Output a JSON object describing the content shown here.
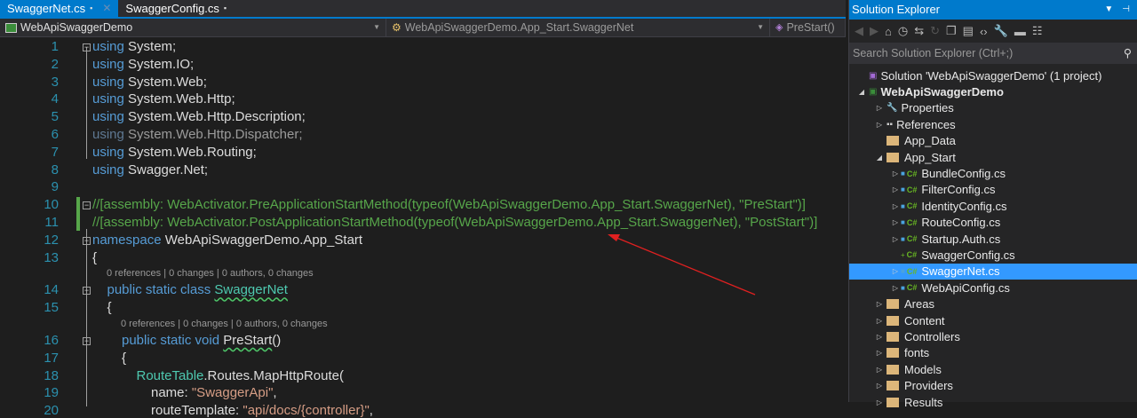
{
  "tabs": [
    {
      "label": "SwaggerNet.cs",
      "active": true
    },
    {
      "label": "SwaggerConfig.cs",
      "active": false
    }
  ],
  "navbar": {
    "project": "WebApiSwaggerDemo",
    "type": "WebApiSwaggerDemo.App_Start.SwaggerNet",
    "member": "PreStart()"
  },
  "code": [
    {
      "n": "1",
      "indent": 0,
      "t": [
        [
          "using",
          "kw"
        ],
        [
          " System;",
          ""
        ]
      ]
    },
    {
      "n": "2",
      "indent": 0,
      "t": [
        [
          "using",
          "kw"
        ],
        [
          " System.IO;",
          ""
        ]
      ]
    },
    {
      "n": "3",
      "indent": 0,
      "t": [
        [
          "using",
          "kw"
        ],
        [
          " System.Web;",
          ""
        ]
      ]
    },
    {
      "n": "4",
      "indent": 0,
      "t": [
        [
          "using",
          "kw"
        ],
        [
          " System.Web.Http;",
          ""
        ]
      ]
    },
    {
      "n": "5",
      "indent": 0,
      "t": [
        [
          "using",
          "kw"
        ],
        [
          " System.Web.Http.Description;",
          ""
        ]
      ]
    },
    {
      "n": "6",
      "indent": 0,
      "t": [
        [
          "using",
          "dimu"
        ],
        [
          " System.Web.Http.Dispatcher;",
          "dimt"
        ]
      ]
    },
    {
      "n": "7",
      "indent": 0,
      "t": [
        [
          "using",
          "kw"
        ],
        [
          " System.Web.Routing;",
          ""
        ]
      ]
    },
    {
      "n": "8",
      "indent": 0,
      "t": [
        [
          "using",
          "kw"
        ],
        [
          " Swagger.Net;",
          ""
        ]
      ]
    },
    {
      "n": "9",
      "indent": 0,
      "t": []
    },
    {
      "n": "10",
      "indent": 0,
      "t": [
        [
          "//[assembly: WebActivator.PreApplicationStartMethod(typeof(WebApiSwaggerDemo.App_Start.SwaggerNet), \"PreStart\")]",
          "cm"
        ]
      ]
    },
    {
      "n": "11",
      "indent": 0,
      "t": [
        [
          "//[assembly: WebActivator.PostApplicationStartMethod(typeof(WebApiSwaggerDemo.App_Start.SwaggerNet), \"PostStart\")]",
          "cm"
        ]
      ]
    },
    {
      "n": "12",
      "indent": 0,
      "t": [
        [
          "namespace",
          "kw"
        ],
        [
          " WebApiSwaggerDemo.App_Start",
          ""
        ]
      ]
    },
    {
      "n": "13",
      "indent": 0,
      "t": [
        [
          "{",
          ""
        ]
      ]
    },
    {
      "n": "14",
      "indent": 1,
      "lens": "0 references | 0 changes | 0 authors, 0 changes",
      "t": [
        [
          "public static class",
          "kw"
        ],
        [
          " ",
          ""
        ],
        [
          "SwaggerNet",
          "ty sq"
        ]
      ]
    },
    {
      "n": "15",
      "indent": 1,
      "t": [
        [
          "{",
          ""
        ]
      ]
    },
    {
      "n": "16",
      "indent": 2,
      "lens": "0 references | 0 changes | 0 authors, 0 changes",
      "t": [
        [
          "public static void",
          "kw"
        ],
        [
          " ",
          ""
        ],
        [
          "PreStart",
          "sq"
        ],
        [
          "()",
          ""
        ]
      ]
    },
    {
      "n": "17",
      "indent": 2,
      "t": [
        [
          "{",
          ""
        ]
      ]
    },
    {
      "n": "18",
      "indent": 3,
      "t": [
        [
          "RouteTable",
          "ty"
        ],
        [
          ".Routes.MapHttpRoute(",
          ""
        ]
      ]
    },
    {
      "n": "19",
      "indent": 4,
      "t": [
        [
          "name: ",
          ""
        ],
        [
          "\"SwaggerApi\"",
          "st"
        ],
        [
          ",",
          ""
        ]
      ]
    },
    {
      "n": "20",
      "indent": 4,
      "t": [
        [
          "routeTemplate: ",
          ""
        ],
        [
          "\"api/docs/{controller}\"",
          "st"
        ],
        [
          ",",
          ""
        ]
      ]
    }
  ],
  "solution_explorer": {
    "title": "Solution Explorer",
    "search_placeholder": "Search Solution Explorer (Ctrl+;)",
    "items": [
      {
        "label": "Solution 'WebApiSwaggerDemo' (1 project)",
        "level": 0,
        "kind": "solution",
        "arrow": ""
      },
      {
        "label": "WebApiSwaggerDemo",
        "level": 0,
        "kind": "project",
        "arrow": "◢",
        "bold": true
      },
      {
        "label": "Properties",
        "level": 1,
        "kind": "props",
        "arrow": "▷"
      },
      {
        "label": "References",
        "level": 1,
        "kind": "refs",
        "arrow": "▷"
      },
      {
        "label": "App_Data",
        "level": 1,
        "kind": "folder",
        "arrow": ""
      },
      {
        "label": "App_Start",
        "level": 1,
        "kind": "folder",
        "arrow": "◢"
      },
      {
        "label": "BundleConfig.cs",
        "level": 2,
        "kind": "cs",
        "arrow": "▷"
      },
      {
        "label": "FilterConfig.cs",
        "level": 2,
        "kind": "cs",
        "arrow": "▷"
      },
      {
        "label": "IdentityConfig.cs",
        "level": 2,
        "kind": "cs",
        "arrow": "▷"
      },
      {
        "label": "RouteConfig.cs",
        "level": 2,
        "kind": "cs",
        "arrow": "▷"
      },
      {
        "label": "Startup.Auth.cs",
        "level": 2,
        "kind": "cs",
        "arrow": "▷"
      },
      {
        "label": "SwaggerConfig.cs",
        "level": 2,
        "kind": "cs-add",
        "arrow": ""
      },
      {
        "label": "SwaggerNet.cs",
        "level": 2,
        "kind": "cs",
        "arrow": "▷",
        "selected": true
      },
      {
        "label": "WebApiConfig.cs",
        "level": 2,
        "kind": "cs",
        "arrow": "▷"
      },
      {
        "label": "Areas",
        "level": 1,
        "kind": "folder",
        "arrow": "▷"
      },
      {
        "label": "Content",
        "level": 1,
        "kind": "folder",
        "arrow": "▷"
      },
      {
        "label": "Controllers",
        "level": 1,
        "kind": "folder",
        "arrow": "▷"
      },
      {
        "label": "fonts",
        "level": 1,
        "kind": "folder",
        "arrow": "▷"
      },
      {
        "label": "Models",
        "level": 1,
        "kind": "folder",
        "arrow": "▷"
      },
      {
        "label": "Providers",
        "level": 1,
        "kind": "folder",
        "arrow": "▷"
      },
      {
        "label": "Results",
        "level": 1,
        "kind": "folder",
        "arrow": "▷"
      }
    ]
  },
  "colors": {
    "accent": "#007acc",
    "annotation_arrow": "#e02020"
  }
}
